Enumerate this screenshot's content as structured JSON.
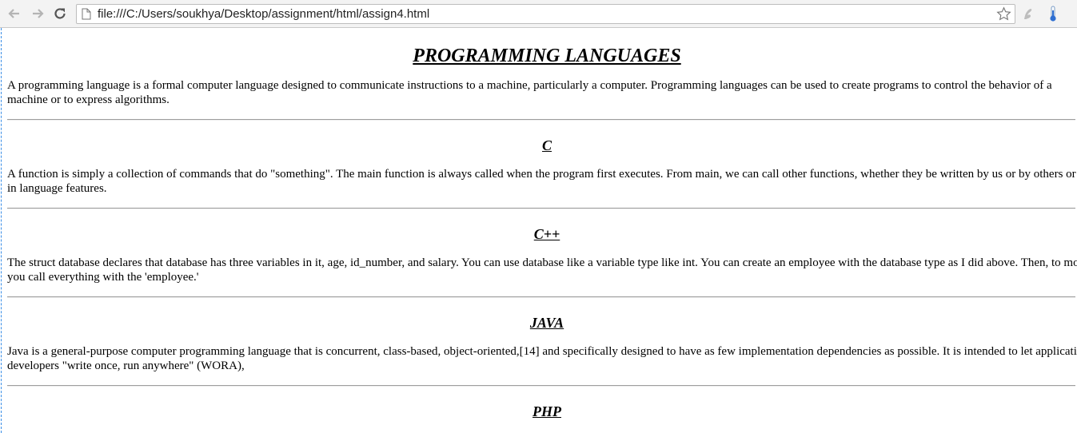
{
  "browser": {
    "url": "file:///C:/Users/soukhya/Desktop/assignment/html/assign4.html"
  },
  "page": {
    "title": "PROGRAMMING LANGUAGES",
    "intro": "A programming language is a formal computer language designed to communicate instructions to a machine, particularly a computer. Programming languages can be used to create programs to control the behavior of a machine or to express algorithms.",
    "sections": [
      {
        "heading": "C",
        "body": "A function is simply a collection of commands that do \"something\". The main function is always called when the program first executes. From main, we can call other functions, whether they be written by us or by others or use built-in language features."
      },
      {
        "heading": "C++",
        "body": "The struct database declares that database has three variables in it, age, id_number, and salary. You can use database like a variable type like int. You can create an employee with the database type as I did above. Then, to modify it you call everything with the 'employee.'"
      },
      {
        "heading": "JAVA",
        "body": "Java is a general-purpose computer programming language that is concurrent, class-based, object-oriented,[14] and specifically designed to have as few implementation dependencies as possible. It is intended to let application developers \"write once, run anywhere\" (WORA),"
      },
      {
        "heading": "PHP",
        "body": ""
      }
    ]
  }
}
